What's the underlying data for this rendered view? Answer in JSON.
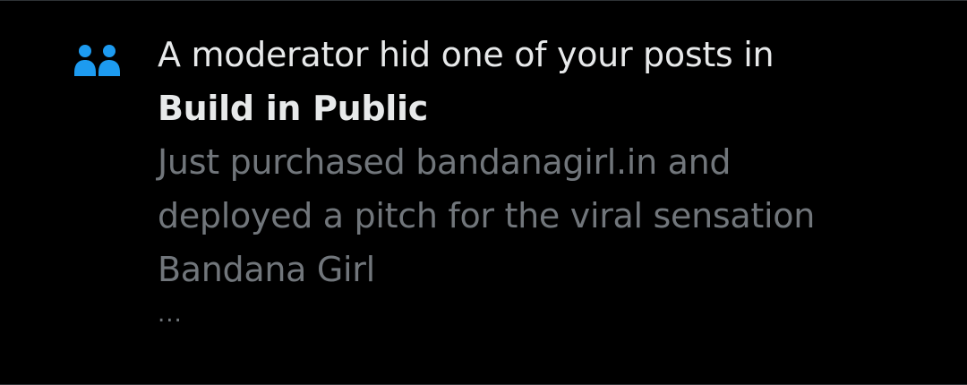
{
  "notification": {
    "icon": "community-icon",
    "accent_color": "#1d9bf0",
    "headline_text": "A moderator hid one of your posts in",
    "community_name": "Build in Public",
    "post_preview": "Just purchased bandanagirl.in and\ndeployed a pitch for the viral sensation\nBandana Girl",
    "ellipsis": "..."
  }
}
